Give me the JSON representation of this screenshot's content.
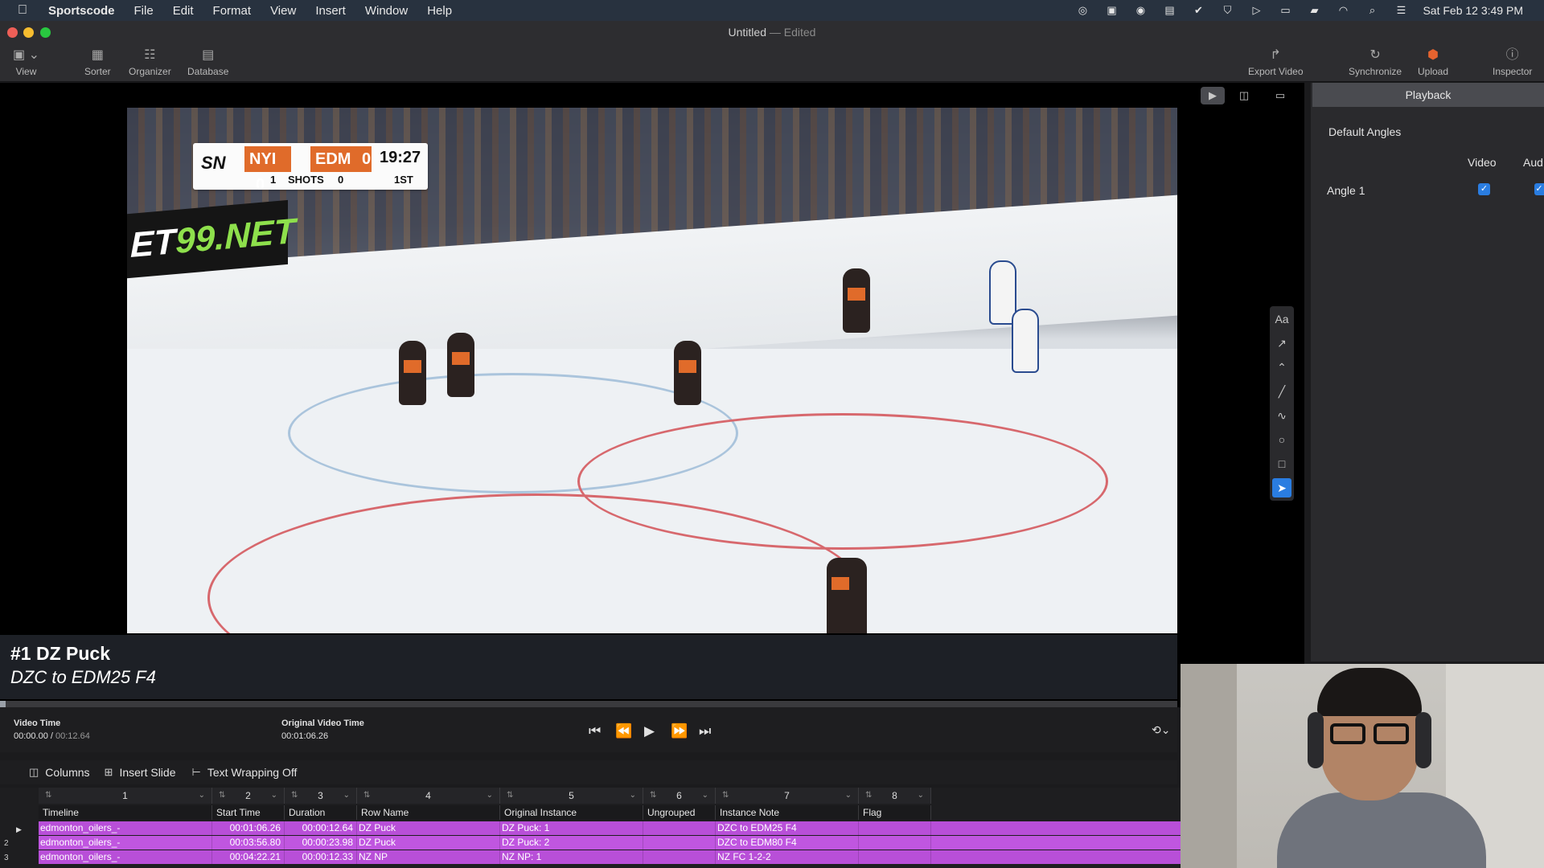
{
  "menubar": {
    "app_name": "Sportscode",
    "items": [
      "File",
      "Edit",
      "Format",
      "View",
      "Insert",
      "Window",
      "Help"
    ],
    "clock": "Sat Feb 12  3:49 PM"
  },
  "window": {
    "title": "Untitled",
    "title_sep": "—",
    "title_state": "Edited"
  },
  "toolbar": {
    "view": "View",
    "sorter": "Sorter",
    "organizer": "Organizer",
    "database": "Database",
    "export_video": "Export Video",
    "synchronize": "Synchronize",
    "upload": "Upload",
    "inspector": "Inspector"
  },
  "scorebug": {
    "network": "SN",
    "away_team": "NYI",
    "away_score": "0",
    "home_team": "EDM",
    "home_score": "0",
    "clock": "19:27",
    "away_shots": "1",
    "shots_label": "SHOTS",
    "home_shots": "0",
    "period": "1ST"
  },
  "ad_board": {
    "text_a": "ET",
    "text_b": "99.NET"
  },
  "clip": {
    "title": "#1 DZ Puck",
    "subtitle": "DZC to EDM25 F4"
  },
  "inspector": {
    "tab": "Playback",
    "section": "Default Angles",
    "col_video": "Video",
    "col_audio": "Aud",
    "angle": "Angle 1"
  },
  "transport": {
    "video_time_label": "Video Time",
    "video_time": "00:00.00",
    "video_time_sep": "/",
    "video_duration": "00:12.64",
    "original_time_label": "Original Video Time",
    "original_time": "00:01:06.26",
    "progress": 0.005
  },
  "table_toolbar": {
    "columns": "Columns",
    "insert_slide": "Insert Slide",
    "text_wrapping": "Text Wrapping Off"
  },
  "table": {
    "column_numbers": [
      "1",
      "2",
      "3",
      "4",
      "5",
      "6",
      "7",
      "8"
    ],
    "headers": [
      "Timeline",
      "Start Time",
      "Duration",
      "Row Name",
      "Original Instance",
      "Ungrouped",
      "Instance Note",
      "Flag"
    ],
    "row_numbers": [
      "2",
      "3"
    ],
    "rows": [
      [
        "edmonton_oilers_-",
        "00:01:06.26",
        "00:00:12.64",
        "DZ Puck",
        "DZ Puck: 1",
        "",
        "DZC to EDM25 F4",
        ""
      ],
      [
        "edmonton_oilers_-",
        "00:03:56.80",
        "00:00:23.98",
        "DZ Puck",
        "DZ Puck: 2",
        "",
        "DZC to EDM80 F4",
        ""
      ],
      [
        "edmonton_oilers_-",
        "00:04:22.21",
        "00:00:12.33",
        "NZ NP",
        "NZ NP: 1",
        "",
        "NZ FC 1-2-2",
        ""
      ]
    ]
  },
  "colors": {
    "row_highlight": "#b84fd8",
    "accent": "#2a7de1",
    "menubar": "#28323f"
  }
}
